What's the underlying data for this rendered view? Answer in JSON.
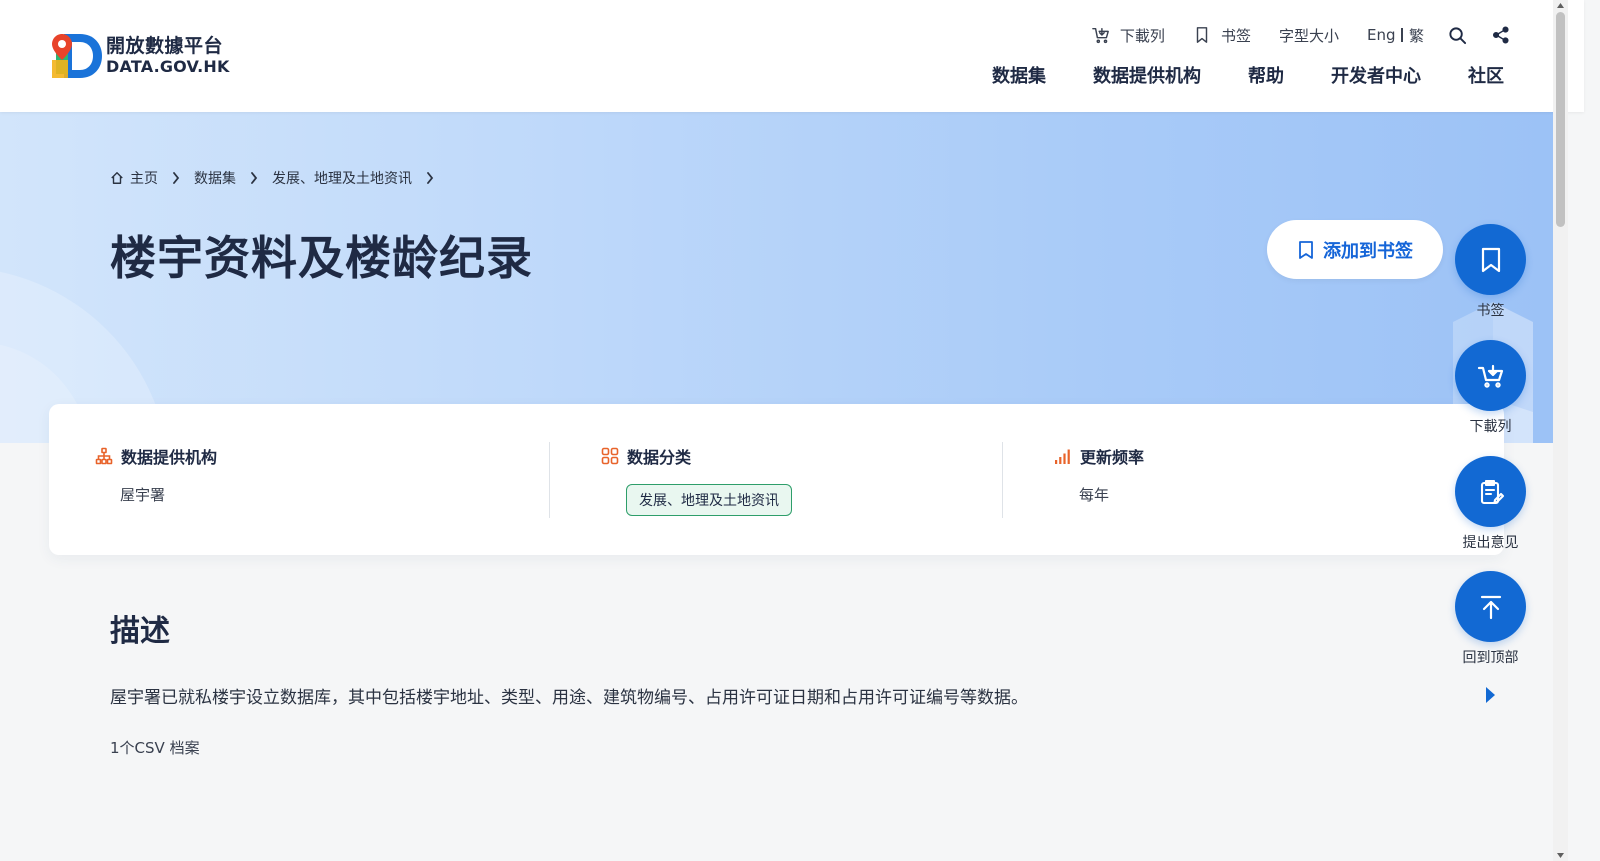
{
  "header": {
    "logo_cn": "開放數據平台",
    "logo_en": "DATA.GOV.HK",
    "utility": {
      "download_list": "下載列",
      "bookmark": "书签",
      "font_size": "字型大小",
      "lang_en": "Eng",
      "lang_tc": "繁",
      "search_icon": "search-icon",
      "share_icon": "share-icon"
    },
    "nav": [
      {
        "label": "数据集"
      },
      {
        "label": "数据提供机构"
      },
      {
        "label": "帮助"
      },
      {
        "label": "开发者中心"
      },
      {
        "label": "社区"
      }
    ]
  },
  "breadcrumb": [
    {
      "label": "主页",
      "icon": "home-icon"
    },
    {
      "label": "数据集"
    },
    {
      "label": "发展、地理及土地资讯"
    }
  ],
  "page": {
    "title": "楼宇资料及楼龄纪录",
    "bookmark_button": "添加到书签"
  },
  "info": {
    "provider": {
      "heading": "数据提供机构",
      "value": "屋宇署"
    },
    "category": {
      "heading": "数据分类",
      "value": "发展、地理及土地资讯"
    },
    "frequency": {
      "heading": "更新频率",
      "value": "每年"
    }
  },
  "description": {
    "title": "描述",
    "text": "屋宇署已就私楼宇设立数据库，其中包括楼宇地址、类型、用途、建筑物编号、占用许可证日期和占用许可证编号等数据。",
    "file_count": "1个CSV 档案"
  },
  "floating_actions": [
    {
      "label": "书签",
      "icon": "bookmark-icon"
    },
    {
      "label": "下載列",
      "icon": "cart-download-icon"
    },
    {
      "label": "提出意见",
      "icon": "feedback-icon"
    },
    {
      "label": "回到顶部",
      "icon": "arrow-up-icon"
    }
  ],
  "colors": {
    "primary": "#1269d3",
    "accent_orange": "#e8632a",
    "tag_green": "#2e9e6a",
    "heading": "#1f2a44"
  }
}
